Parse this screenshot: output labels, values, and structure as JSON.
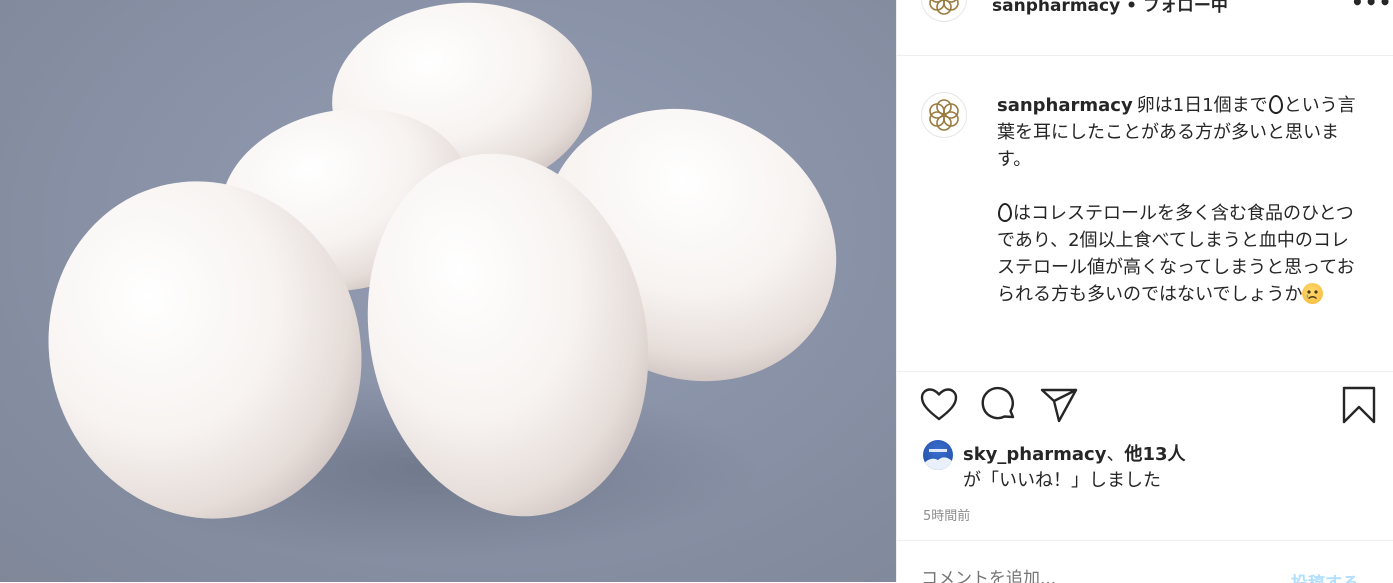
{
  "header": {
    "username": "sanpharmacy",
    "separator": "•",
    "follow_label": "フォロー中",
    "more_icon": "more-horizontal-icon"
  },
  "caption": {
    "username": "sanpharmacy",
    "line1_text": "卵は1日1個まで",
    "line1_rest": "という言葉を耳にしたことがある方が多いと思います。",
    "para2_start": "はコレステロールを多く含む食品のひとつであり、2個以上食べてしまうと血中のコレステロール値が高くなってしまうと思っておられる方も多いのではないでしょうか",
    "emoji_egg": "egg-icon",
    "emoji_sad": "sad-face-icon"
  },
  "actions": {
    "like_icon": "heart-icon",
    "comment_icon": "comment-bubble-icon",
    "share_icon": "paper-plane-icon",
    "save_icon": "bookmark-icon"
  },
  "likes": {
    "user": "sky_pharmacy",
    "sep": "、",
    "others": "他13人",
    "suffix": "が「いいね！」しました"
  },
  "timestamp": "5時間前",
  "comment": {
    "placeholder": "コメントを追加...",
    "post_label": "投稿する"
  },
  "colors": {
    "post_button": "#b2dffc",
    "muted_text": "#8e8e8e",
    "logo_gold": "#9a7a3e"
  }
}
